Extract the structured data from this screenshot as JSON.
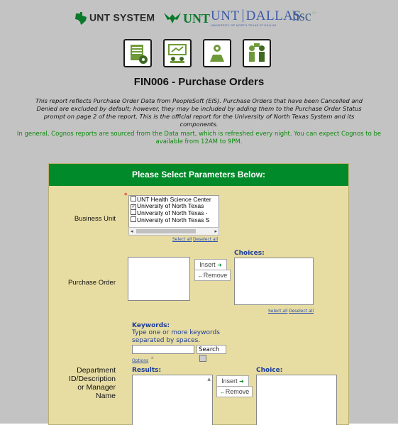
{
  "header": {
    "unt_system": "UNT SYSTEM",
    "unt": "UNT",
    "unt_dallas_a": "UNT",
    "unt_dallas_b": "DALLAS",
    "unt_dallas_sub": "UNIVERSITY OF NORTH TEXAS AT DALLAS",
    "hsc": "hsc"
  },
  "report": {
    "title": "FIN006 - Purchase Orders",
    "description": "This report reflects Purchase Order Data from PeopleSoft (EIS).  Purchase Orders that have been Cancelled and Denied are excluded by default; however, they may be included by adding them to the Purchase Order Status prompt on page 2 of the report. This is the official report for the University of North Texas System and its components.",
    "note": "In general, Cognos reports are sourced from the Data mart, which is refreshed every night. You can expect Cognos to be available from 12AM to 9PM."
  },
  "panel": {
    "header": "Please Select Parameters Below:",
    "business_unit": {
      "label": "Business Unit",
      "required_mark": "*",
      "options": [
        {
          "label": "UNT Health Science Center",
          "checked": false,
          "mark": ""
        },
        {
          "label": "University of North Texas",
          "checked": true,
          "mark": "✓"
        },
        {
          "label": "University of North Texas - ",
          "checked": false,
          "mark": ""
        },
        {
          "label": "University of North Texas S",
          "checked": false,
          "mark": ""
        }
      ],
      "select_all": "Select all",
      "deselect_all": "Deselect all"
    },
    "purchase_order": {
      "label": "Purchase Order",
      "insert": "Insert",
      "remove": "Remove",
      "choices": "Choices:",
      "select_all": "Select all",
      "deselect_all": "Deselect all"
    },
    "department": {
      "label_1": "Department",
      "label_2": "ID/Description",
      "label_3": "or Manager",
      "label_4": "Name",
      "keywords": "Keywords:",
      "keywords_help_1": "Type one or more keywords",
      "keywords_help_2": "separated by spaces.",
      "search": "Search",
      "options": "Options",
      "results": "Results:",
      "insert": "Insert",
      "remove": "Remove",
      "choice": "Choice:"
    }
  },
  "colors": {
    "panel_header": "#008a29",
    "panel_bg": "#e7dca2",
    "note_green": "#0b8a0b",
    "link_blue": "#2b4fb0"
  }
}
